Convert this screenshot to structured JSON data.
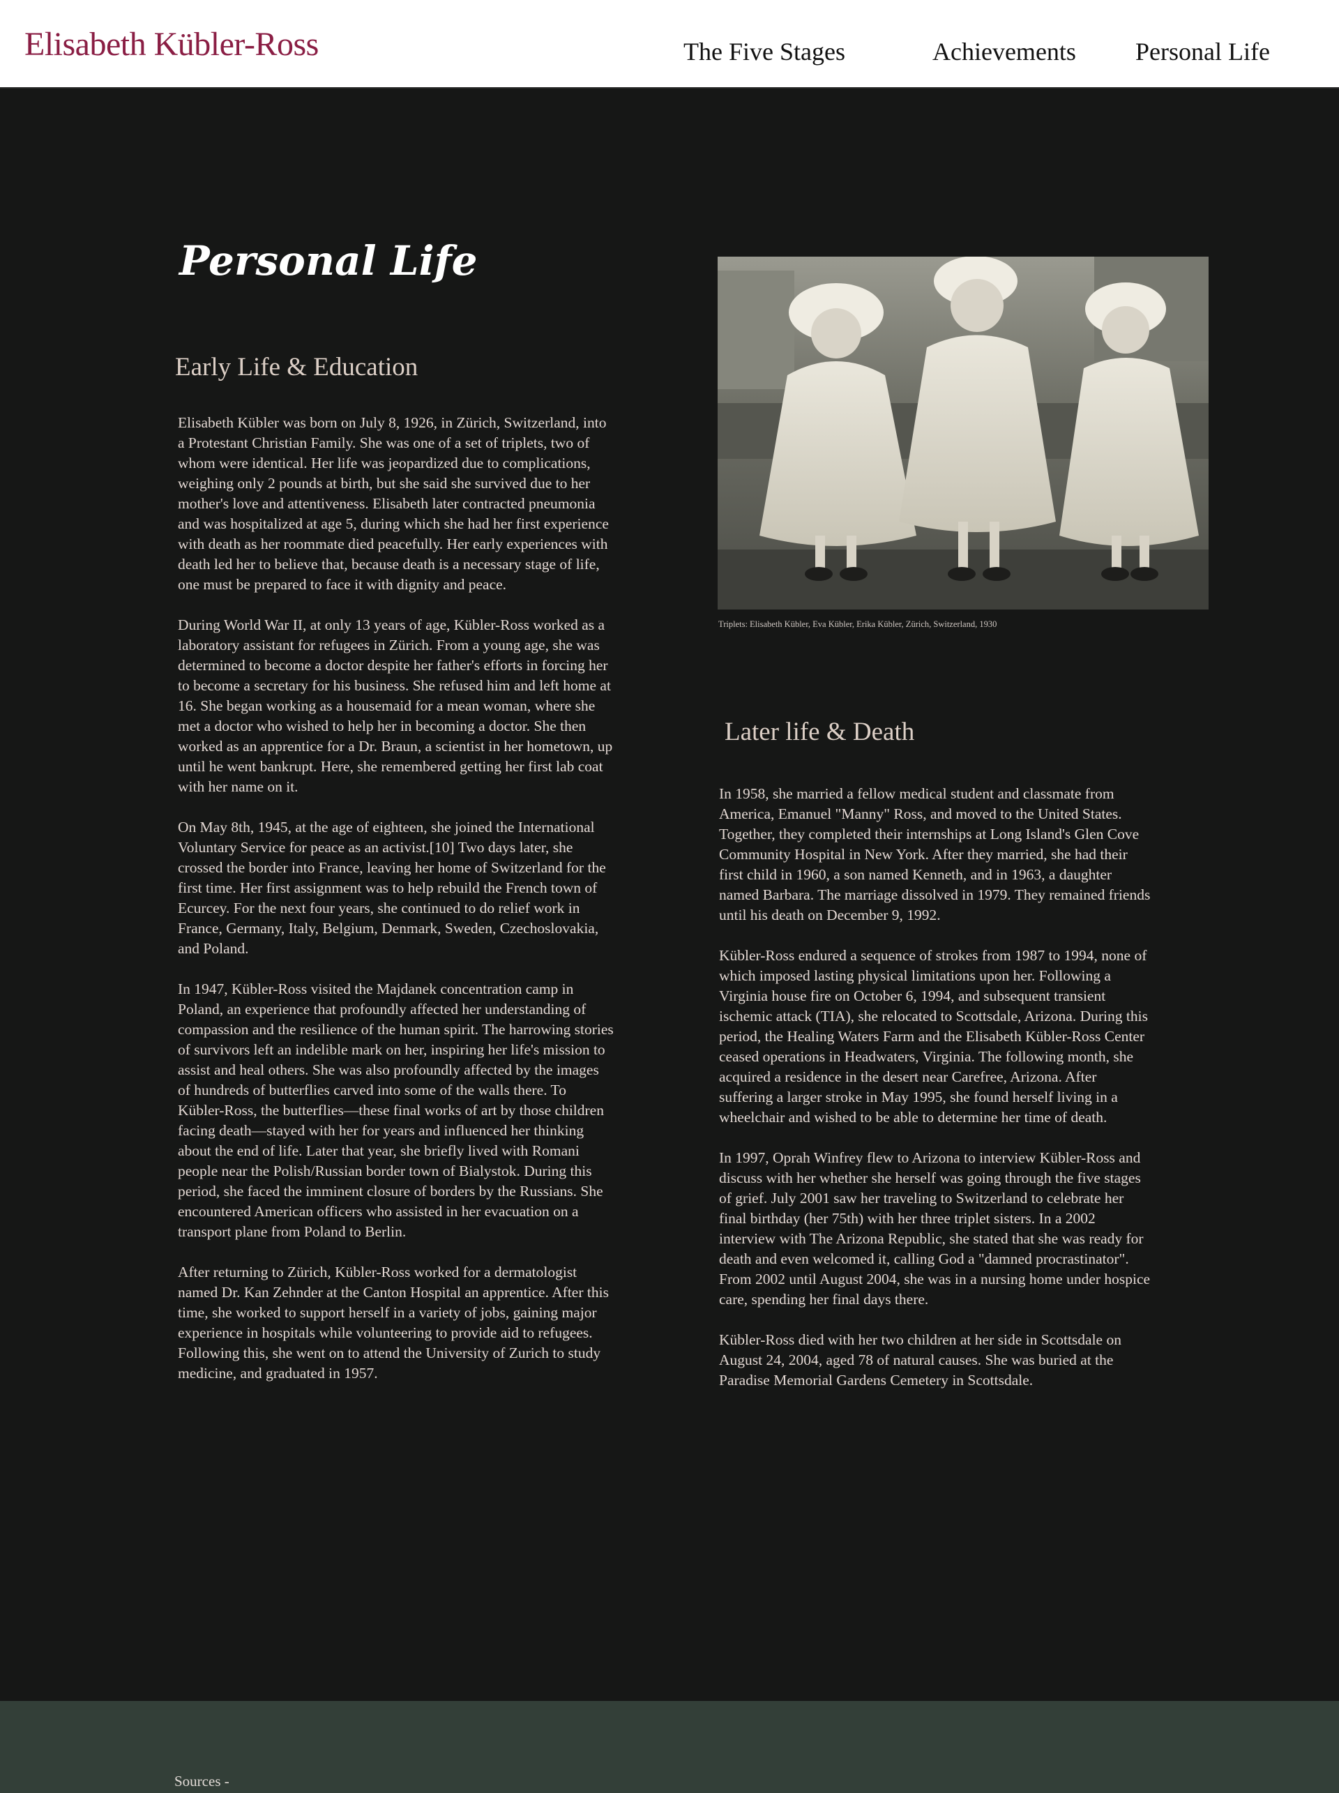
{
  "header": {
    "brand": "Elisabeth Kübler-Ross",
    "nav": [
      "The Five Stages",
      "Achievements",
      "Personal Life"
    ]
  },
  "main": {
    "title": "Personal Life",
    "early": {
      "heading": "Early Life & Education",
      "paragraphs": [
        "Elisabeth Kübler was born on July 8, 1926, in Zürich, Switzerland, into a Protestant Christian Family. She was one of a set of triplets, two of whom were identical. Her life was jeopardized due to complications, weighing only 2 pounds at birth, but she said she survived due to her mother's love and attentiveness. Elisabeth later contracted pneumonia and was hospitalized at age 5, during which she had her first experience with death as her roommate died peacefully. Her early experiences with death led her to believe that, because death is a necessary stage of life, one must be prepared to face it with dignity and peace.",
        "During World War II, at only 13 years of age, Kübler-Ross worked as a laboratory assistant for refugees in Zürich. From a young age, she was determined to become a doctor despite her father's efforts in forcing her to become a secretary for his business. She refused him and left home at 16. She began working as a housemaid for a mean woman, where she met a doctor who wished to help her in becoming a doctor. She then worked as an apprentice for a Dr. Braun, a scientist in her hometown, up until he went bankrupt. Here, she remembered getting her first lab coat with her name on it.",
        "On May 8th, 1945, at the age of eighteen, she joined the International Voluntary Service for peace as an activist.[10] Two days later, she crossed the border into France, leaving her home of Switzerland for the first time. Her first assignment was to help rebuild the French town of Ecurcey. For the next four years, she continued to do relief work in France, Germany, Italy, Belgium, Denmark, Sweden, Czechoslovakia, and Poland.",
        "In 1947, Kübler-Ross visited the Majdanek concentration camp in Poland, an experience that profoundly affected her understanding of compassion and the resilience of the human spirit. The harrowing stories of survivors left an indelible mark on her, inspiring her life's mission to assist and heal others. She was also profoundly affected by the images of hundreds of butterflies carved into some of the walls there. To Kübler-Ross, the butterflies—these final works of art by those children facing death—stayed with her for years and influenced her thinking about the end of life. Later that year, she briefly lived with Romani people near the Polish/Russian border town of Bialystok. During this period, she faced the imminent closure of borders by the Russians. She encountered American officers who assisted in her evacuation on a transport plane from Poland to Berlin.",
        "After returning to Zürich, Kübler-Ross worked for a dermatologist named Dr. Kan Zehnder at the Canton Hospital an apprentice. After this time, she worked to support herself in a variety of jobs, gaining major experience in hospitals while volunteering to provide aid to refugees. Following this, she went on to attend the University of Zurich to study medicine, and graduated in 1957."
      ]
    },
    "photo": {
      "caption": "Triplets: Elisabeth Kübler, Eva Kübler, Erika Kübler, Zürich, Switzerland, 1930"
    },
    "later": {
      "heading": "Later life & Death",
      "paragraphs": [
        "In 1958, she married a fellow medical student and classmate from America, Emanuel \"Manny\" Ross, and moved to the United States. Together, they completed their internships at Long Island's Glen Cove Community Hospital in New York. After they married, she had their first child in 1960, a son named Kenneth, and in 1963, a daughter named Barbara. The marriage dissolved in 1979. They remained friends until his death on December 9, 1992.",
        "Kübler-Ross endured a sequence of strokes from 1987 to 1994, none of which imposed lasting physical limitations upon her. Following a Virginia house fire on October 6, 1994, and subsequent transient ischemic attack (TIA), she relocated to Scottsdale, Arizona. During this period, the Healing Waters Farm and the Elisabeth Kübler-Ross Center ceased operations in Headwaters, Virginia. The following month, she acquired a residence in the desert near Carefree, Arizona. After suffering a larger stroke in May 1995, she found herself living in a wheelchair and wished to be able to determine her time of death.",
        "In 1997, Oprah Winfrey flew to Arizona to interview Kübler-Ross and discuss with her whether she herself was going through the five stages of grief. July 2001 saw her traveling to Switzerland to celebrate her final birthday (her 75th) with her three triplet sisters. In a 2002 interview with The Arizona Republic, she stated that she was ready for death and even welcomed it, calling God a \"damned procrastinator\". From 2002 until August 2004, she was in a nursing home under hospice care, spending her final days there.",
        "Kübler-Ross died with her two children at her side in Scottsdale on August 24, 2004, aged 78 of natural causes. She was buried at the Paradise Memorial Gardens Cemetery in Scottsdale."
      ]
    }
  },
  "footer": {
    "sources": "Sources -"
  }
}
